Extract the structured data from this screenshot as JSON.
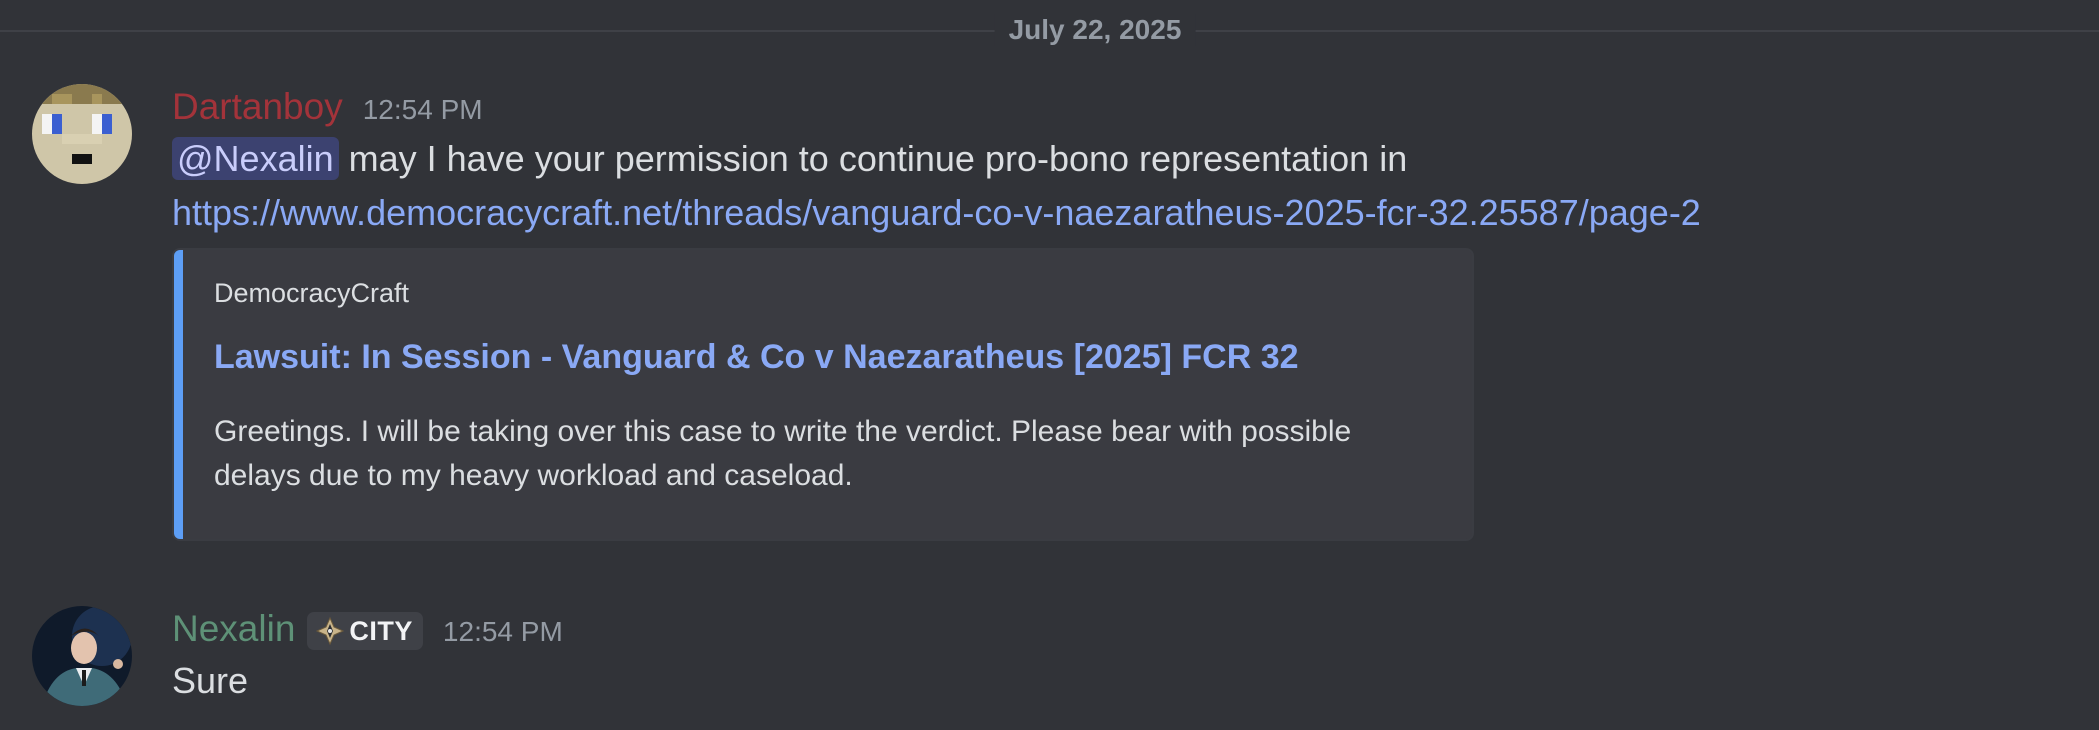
{
  "date_divider": "July 22, 2025",
  "messages": [
    {
      "username": "Dartanboy",
      "timestamp": "12:54 PM",
      "mention": "@Nexalin",
      "text": "may I have your permission to continue pro-bono representation in",
      "link": "https://www.democracycraft.net/threads/vanguard-co-v-naezaratheus-2025-fcr-32.25587/page-2",
      "embed": {
        "provider": "DemocracyCraft",
        "title": "Lawsuit: In Session - Vanguard & Co v Naezaratheus [2025] FCR 32",
        "description": "Greetings. I will be taking over this case to write the verdict. Please bear with possible delays due to my heavy workload and caseload.",
        "accent_color": "#5d9ef5"
      },
      "username_color": "#a3333a",
      "avatar_icon": "pixel-face-avatar"
    },
    {
      "username": "Nexalin",
      "role_tag": "CITY",
      "role_icon": "compass-diamond-icon",
      "timestamp": "12:54 PM",
      "text": "Sure",
      "username_color": "#5e9177",
      "avatar_icon": "person-photo-avatar"
    }
  ]
}
